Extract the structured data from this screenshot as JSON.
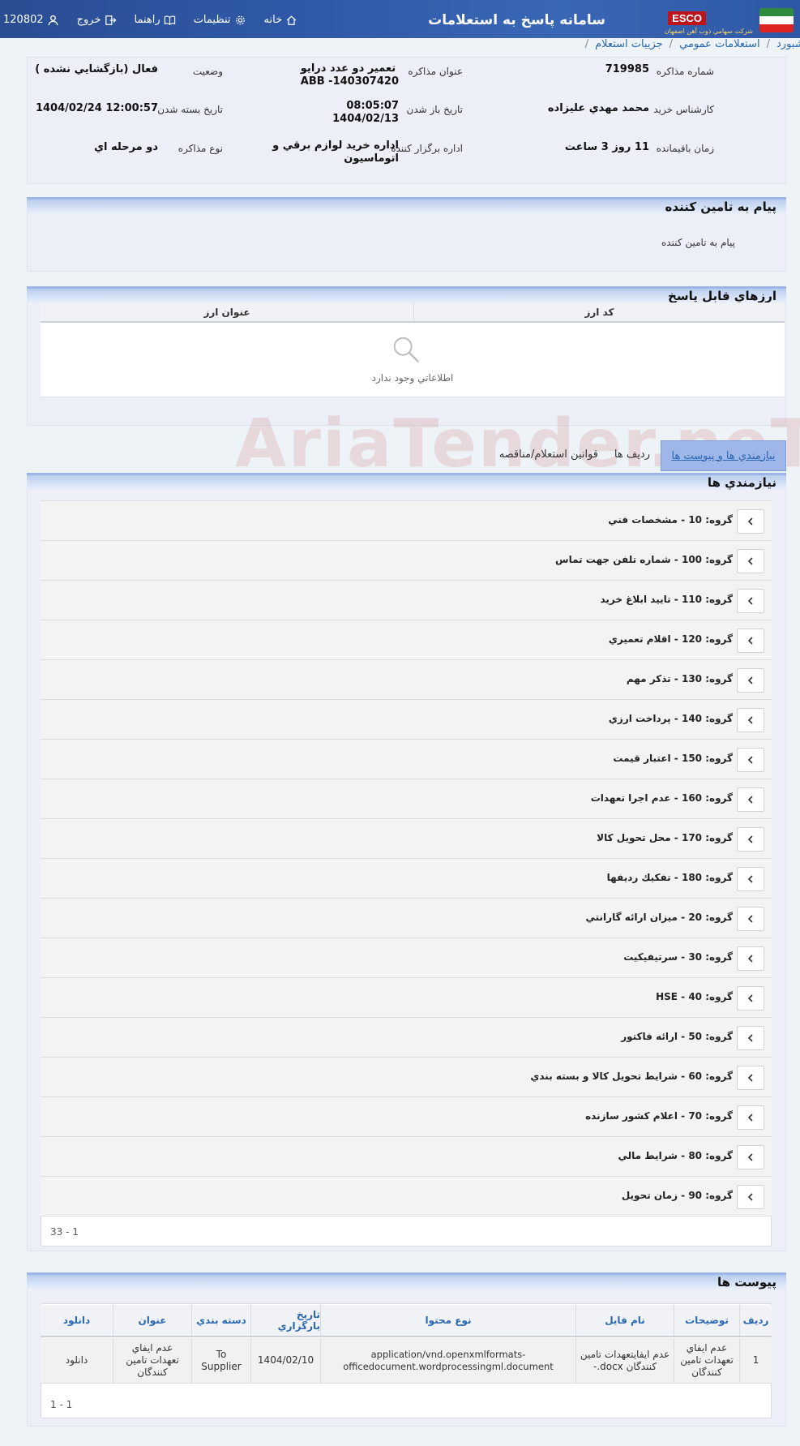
{
  "header": {
    "app_title": "سامانه پاسخ به استعلامات",
    "logo_text": "ESCO",
    "logo_subtitle": "شركت سهامي ذوب آهن اصفهان",
    "nav": {
      "home": "خانه",
      "settings": "تنظيمات",
      "help": "راهنما",
      "logout": "خروج",
      "user_id": "120802"
    }
  },
  "breadcrumb": [
    "داشبورد",
    "استعلامات عمومي",
    "جزييات استعلام"
  ],
  "inquiry": {
    "number_label": "شماره مذاكره",
    "number": "719985",
    "title_label": "عنوان مذاكره",
    "title_line1": "تعمير دو عدد درايو",
    "title_line2": "ABB -140307420",
    "status_label": "وضعيت",
    "status": "فعال (بازگشايي نشده )",
    "buyer_label": "كارشناس خريد",
    "buyer": "محمد مهدي عليزاده",
    "open_date_label": "تاريخ باز شدن",
    "open_time": "08:05:07",
    "open_date": "1404/02/13",
    "close_date_label": "تاريخ بسته شدن",
    "close_date": "1404/02/24 12:00:57",
    "remaining_label": "زمان باقيمانده",
    "remaining": "11 روز 3 ساعت",
    "org_label": "اداره برگزار كننده",
    "org_line1": "اداره خريد لوازم برقي و",
    "org_line2": "اتوماسيون",
    "type_label": "نوع مذاكره",
    "type": "دو مرحله اي"
  },
  "supplier_message": {
    "title": "پيام به تامين كننده",
    "body": "پيام به تامين كننده"
  },
  "currencies": {
    "title": "ارزهاي قابل پاسخ",
    "col_code": "كد ارز",
    "col_title": "عنوان ارز",
    "empty": "اطلاعاتي وجود ندارد"
  },
  "tabs": [
    "نيازمندي ها و پيوست ها",
    "رديف ها",
    "قوانين استعلام/مناقصه"
  ],
  "requirements": {
    "title": "نيازمندي ها",
    "groups": [
      "گروه: 10 - مشخصات فني",
      "گروه: 100 - شماره تلفن جهت تماس",
      "گروه: 110 - تاييد ابلاغ خريد",
      "گروه: 120 - اقلام تعميري",
      "گروه: 130 - تذكر مهم",
      "گروه: 140 - پرداخت ارزي",
      "گروه: 150 - اعتبار قيمت",
      "گروه: 160 - عدم اجرا تعهدات",
      "گروه: 170 - محل تحويل كالا",
      "گروه: 180 - تفكيك رديفها",
      "گروه: 20 - ميزان ارائه گارانتي",
      "گروه: 30 - سرتيفيكيت",
      "گروه: 40 - HSE",
      "گروه: 50 - ارائه فاكتور",
      "گروه: 60 - شرايط تحويل كالا و بسته بندي",
      "گروه: 70 - اعلام كشور سازنده",
      "گروه: 80 - شرايط مالي",
      "گروه: 90 - زمان تحويل"
    ],
    "pager": "1 - 33"
  },
  "attachments": {
    "title": "پيوست ها",
    "columns": [
      "رديف",
      "توضيحات",
      "نام فايل",
      "نوع محتوا",
      "تاريخ بارگزاري",
      "دسته بندي",
      "عنوان",
      "دانلود"
    ],
    "rows": [
      {
        "index": "1",
        "desc": "عدم ايفاي تعهدات تامين كنندگان",
        "file": "عدم ايفايتعهدات تامين كنندگان docx.-",
        "type": "application/vnd.openxmlformats-officedocument.wordprocessingml.document",
        "date": "1404/02/10",
        "category": "To Supplier",
        "title": "عدم ايفاي تعهدات تامين كنندگان",
        "download": "دانلود"
      }
    ],
    "pager": "1 - 1"
  },
  "watermark": "AriaTender.neT",
  "colors": {
    "header_blue": "#2f5aa8",
    "link": "#2a68b2",
    "section": "#9bb6e6"
  }
}
